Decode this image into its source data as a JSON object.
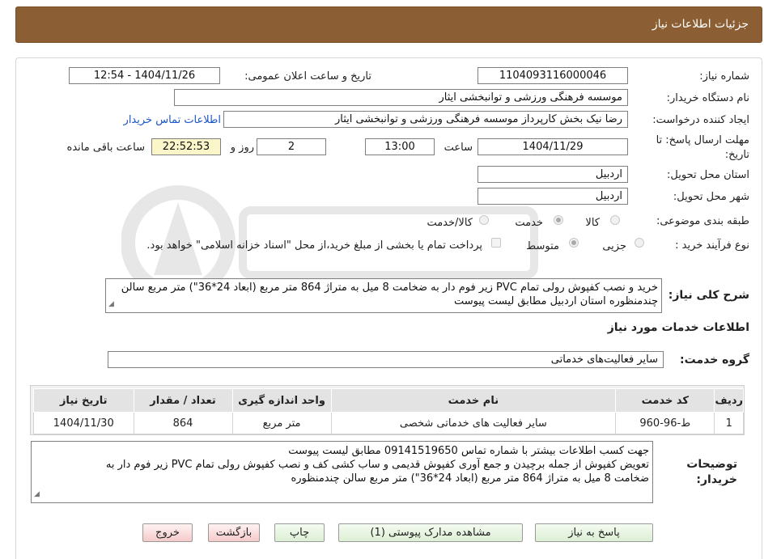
{
  "header": {
    "title": "جزئيات اطلاعات نياز"
  },
  "fields": {
    "need_number_label": "شماره نیاز:",
    "need_number": "1104093116000046",
    "announce_label": "تاریخ و ساعت اعلان عمومی:",
    "announce_value": "1404/11/26 - 12:54",
    "buyer_org_label": "نام دستگاه خریدار:",
    "buyer_org": "موسسه فرهنگی ورزشی و توانبخشی ایثار",
    "requester_label": "ایجاد کننده درخواست:",
    "requester": "رضا نیک بخش کارپرداز موسسه فرهنگی ورزشی و توانبخشی ایثار",
    "contact_link": "اطلاعات تماس خریدار",
    "deadline_label_1": "مهلت ارسال پاسخ: تا",
    "deadline_label_2": "تاریخ:",
    "deadline_date": "1404/11/29",
    "time_label": "ساعت",
    "deadline_time": "13:00",
    "days_value": "2",
    "day_and_label": "روز و",
    "remaining_time": "22:52:53",
    "remaining_label": "ساعت باقی مانده",
    "province_label": "استان محل تحویل:",
    "province": "اردبیل",
    "city_label": "شهر محل تحویل:",
    "city": "اردبیل",
    "category_label": "طبقه بندی موضوعی:",
    "category_options": [
      "کالا",
      "خدمت",
      "کالا/خدمت"
    ],
    "process_label": "نوع فرآیند خرید :",
    "process_options": [
      "جزیی",
      "متوسط"
    ],
    "payment_note": "پرداخت تمام یا بخشی از مبلغ خرید،از محل \"اسناد خزانه اسلامی\" خواهد بود."
  },
  "summary": {
    "label": "شرح کلی نیاز:",
    "text": "خرید و نصب کفپوش رولی تمام PVC زیر فوم دار به ضخامت 8 میل به متراژ 864 متر مربع (ابعاد 24*36\") متر مربع سالن چندمنظوره استان اردبیل مطابق لیست پیوست"
  },
  "services": {
    "section_title": "اطلاعات خدمات مورد نياز",
    "group_label": "گروه خدمت:",
    "group_value": "سایر فعالیت‌های خدماتی",
    "columns": [
      "ردیف",
      "کد خدمت",
      "نام خدمت",
      "واحد اندازه گیری",
      "تعداد / مقدار",
      "تاریخ نیاز"
    ],
    "rows": [
      [
        "1",
        "ط-96-960",
        "سایر فعالیت های خدماتی شخصی",
        "متر مربع",
        "864",
        "1404/11/30"
      ]
    ]
  },
  "buyer_notes": {
    "label_1": "توضیحات",
    "label_2": "خریدار:",
    "line_1": "جهت کسب اطلاعات بیشتر با شماره تماس 09141519650 مطابق لیست پیوست",
    "line_2": "تعویض کفپوش از جمله برچیدن  و جمع آوری کفپوش قدیمی و ساب کشی کف و نصب کفپوش رولی تمام PVC زیر فوم دار به",
    "line_3": "ضخامت 8 میل به متراژ 864 متر مربع (ابعاد 24*36\") متر مربع  سالن چندمنظوره"
  },
  "buttons": {
    "reply": "پاسخ به نیاز",
    "attachments": "مشاهده مدارک پیوستی (1)",
    "print": "چاپ",
    "back": "بازگشت",
    "exit": "خروج"
  },
  "colors": {
    "header_bg": "#8b5e34",
    "remaining_bg": "#fbf6c9",
    "link": "#1a55c6"
  }
}
